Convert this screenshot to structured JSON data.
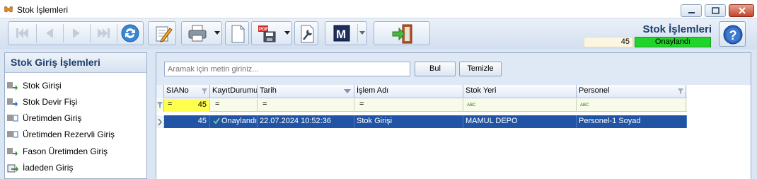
{
  "window": {
    "title": "Stok İşlemleri",
    "controls": [
      "minimize",
      "maximize",
      "close"
    ]
  },
  "toolbar": {
    "buttons": [
      "first-icon",
      "prev-icon",
      "next-icon",
      "last-icon",
      "refresh-icon",
      "edit-icon",
      "print-icon",
      "document-icon",
      "pdf-save-icon",
      "settings-icon",
      "m-icon",
      "exit-icon"
    ]
  },
  "header": {
    "title": "Stok İşlemleri",
    "record_no": "45",
    "status": "Onaylandı",
    "status_color": "#21d429"
  },
  "sidebar": {
    "title": "Stok Giriş İşlemleri",
    "items": [
      {
        "label": "Stok Girişi",
        "icon": "barcode-arrow-icon"
      },
      {
        "label": "Stok Devir Fişi",
        "icon": "barcode-arrow-icon"
      },
      {
        "label": "Üretimden Giriş",
        "icon": "barcode-arrow-icon"
      },
      {
        "label": "Üretimden Rezervli Giriş",
        "icon": "barcode-arrow-icon"
      },
      {
        "label": "Fason Üretimden Giriş",
        "icon": "barcode-arrow-icon"
      },
      {
        "label": "İadeden Giriş",
        "icon": "return-icon"
      }
    ]
  },
  "search": {
    "placeholder": "Aramak için metin giriniz...",
    "find_label": "Bul",
    "clear_label": "Temizle"
  },
  "grid": {
    "columns": [
      "SIANo",
      "KayıtDurumu",
      "Tarih",
      "İşlem Adı",
      "Stok Yeri",
      "Personel"
    ],
    "filter": {
      "sianu_op": "=",
      "sianu_value": "45",
      "kayit_op": "=",
      "tarih_op": "=",
      "islem_op": "=",
      "stok_op": "ABC",
      "personel_op": "ABC"
    },
    "rows": [
      {
        "sianu": "45",
        "kayit": "Onaylandı",
        "tarih": "22.07.2024 10:52:36",
        "islem": "Stok Girişi",
        "stok": "MAMUL DEPO",
        "personel": "Personel-1 Soyad"
      }
    ]
  }
}
